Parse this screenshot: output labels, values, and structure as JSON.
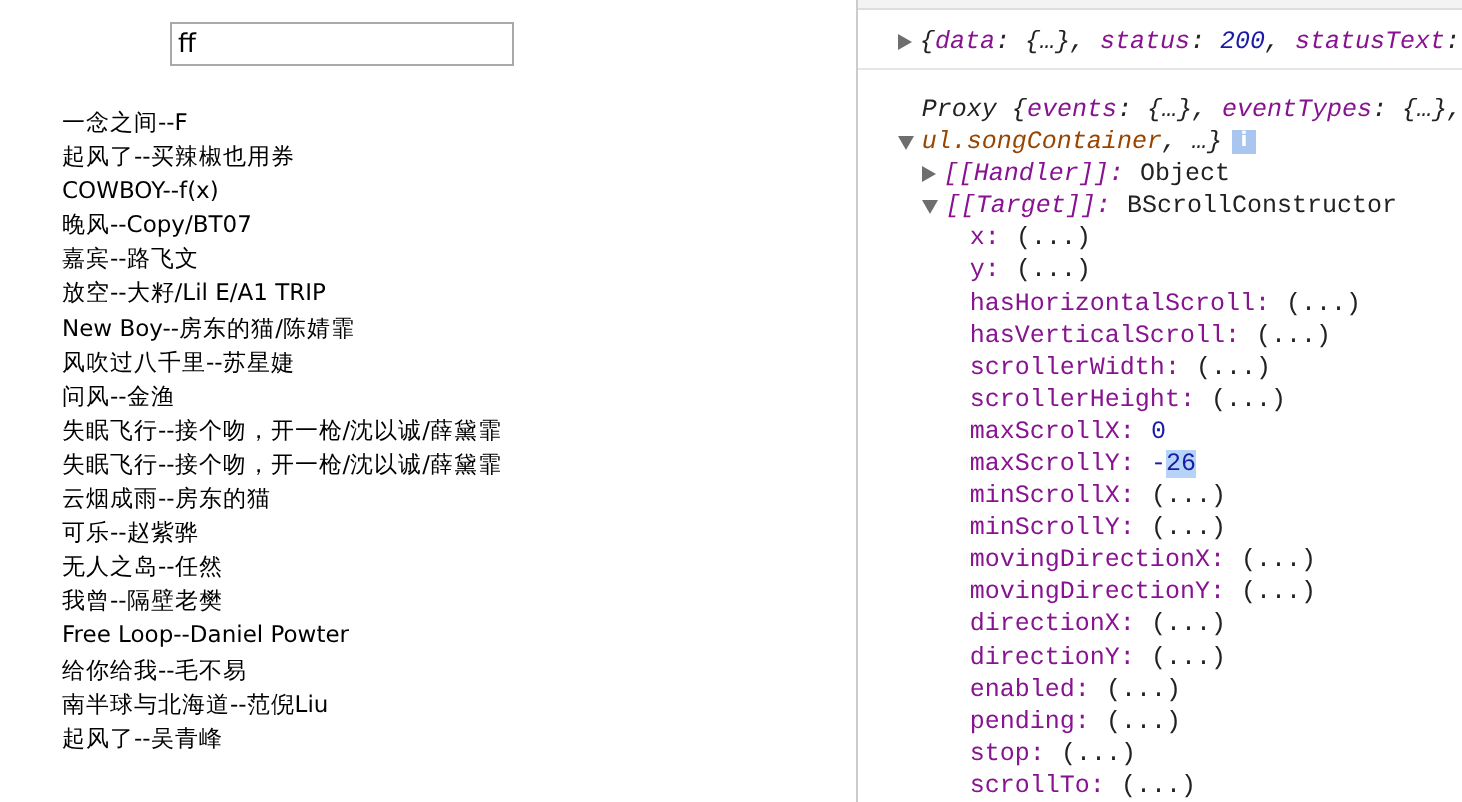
{
  "search": {
    "value": "ff"
  },
  "songs": [
    "一念之间--F",
    "起风了--买辣椒也用券",
    "COWBOY--f(x)",
    "晚风--Copy/BT07",
    "嘉宾--路飞文",
    "放空--大籽/Lil E/A1 TRIP",
    "New Boy--房东的猫/陈婧霏",
    "风吹过八千里--苏星婕",
    "问风--金渔",
    "失眠飞行--接个吻，开一枪/沈以诚/薛黛霏",
    "失眠飞行--接个吻，开一枪/沈以诚/薛黛霏",
    "云烟成雨--房东的猫",
    "可乐--赵紫骅",
    "无人之岛--任然",
    "我曾--隔壁老樊",
    "Free Loop--Daniel Powter",
    "给你给我--毛不易",
    "南半球与北海道--范倪Liu",
    "起风了--吴青峰"
  ],
  "console": {
    "response": {
      "expanded": false,
      "parts": [
        {
          "kind": "punct",
          "text": "{"
        },
        {
          "kind": "key",
          "text": "data"
        },
        {
          "kind": "punct",
          "text": ": {…}, "
        },
        {
          "kind": "key",
          "text": "status"
        },
        {
          "kind": "punct",
          "text": ": "
        },
        {
          "kind": "number",
          "text": "200"
        },
        {
          "kind": "punct",
          "text": ", "
        },
        {
          "kind": "key",
          "text": "statusText"
        },
        {
          "kind": "punct",
          "text": ":"
        }
      ]
    },
    "proxy": {
      "expanded": true,
      "line1": [
        {
          "kind": "punct",
          "text": "Proxy {"
        },
        {
          "kind": "key",
          "text": "events"
        },
        {
          "kind": "punct",
          "text": ": {…}, "
        },
        {
          "kind": "key",
          "text": "eventTypes"
        },
        {
          "kind": "punct",
          "text": ": {…},"
        }
      ],
      "line2": [
        {
          "kind": "element",
          "text": "ul.songContainer"
        },
        {
          "kind": "punct",
          "text": ", …}"
        }
      ],
      "info": "i",
      "children": [
        {
          "name": "[[Handler]]:",
          "value": "Object",
          "expanded": false
        },
        {
          "name": "[[Target]]:",
          "value": "BScrollConstructor",
          "expanded": true,
          "children": [
            {
              "name": "x:",
              "kind": "getter",
              "value": "(...)"
            },
            {
              "name": "y:",
              "kind": "getter",
              "value": "(...)"
            },
            {
              "name": "hasHorizontalScroll:",
              "kind": "getter",
              "value": "(...)"
            },
            {
              "name": "hasVerticalScroll:",
              "kind": "getter",
              "value": "(...)"
            },
            {
              "name": "scrollerWidth:",
              "kind": "getter",
              "value": "(...)"
            },
            {
              "name": "scrollerHeight:",
              "kind": "getter",
              "value": "(...)"
            },
            {
              "name": "maxScrollX:",
              "kind": "number",
              "value": "0"
            },
            {
              "name": "maxScrollY:",
              "kind": "number",
              "value": "-",
              "selection": "26"
            },
            {
              "name": "minScrollX:",
              "kind": "getter",
              "value": "(...)"
            },
            {
              "name": "minScrollY:",
              "kind": "getter",
              "value": "(...)"
            },
            {
              "name": "movingDirectionX:",
              "kind": "getter",
              "value": "(...)"
            },
            {
              "name": "movingDirectionY:",
              "kind": "getter",
              "value": "(...)"
            },
            {
              "name": "directionX:",
              "kind": "getter",
              "value": "(...)"
            },
            {
              "name": "directionY:",
              "kind": "getter",
              "value": "(...)"
            },
            {
              "name": "enabled:",
              "kind": "getter",
              "value": "(...)"
            },
            {
              "name": "pending:",
              "kind": "getter",
              "value": "(...)"
            },
            {
              "name": "stop:",
              "kind": "getter",
              "value": "(...)"
            },
            {
              "name": "scrollTo:",
              "kind": "getter",
              "value": "(...)"
            }
          ]
        }
      ]
    }
  }
}
